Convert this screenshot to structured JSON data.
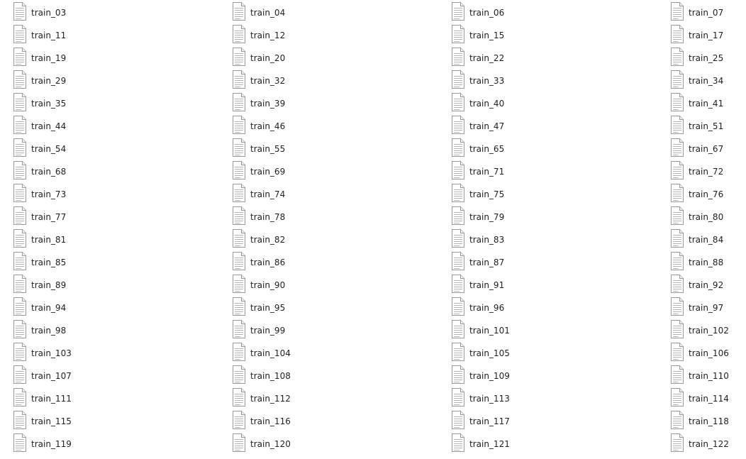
{
  "file_icon": "text-document-icon",
  "rows": [
    [
      "train_03",
      "train_04",
      "train_06",
      "train_07"
    ],
    [
      "train_11",
      "train_12",
      "train_15",
      "train_17"
    ],
    [
      "train_19",
      "train_20",
      "train_22",
      "train_25"
    ],
    [
      "train_29",
      "train_32",
      "train_33",
      "train_34"
    ],
    [
      "train_35",
      "train_39",
      "train_40",
      "train_41"
    ],
    [
      "train_44",
      "train_46",
      "train_47",
      "train_51"
    ],
    [
      "train_54",
      "train_55",
      "train_65",
      "train_67"
    ],
    [
      "train_68",
      "train_69",
      "train_71",
      "train_72"
    ],
    [
      "train_73",
      "train_74",
      "train_75",
      "train_76"
    ],
    [
      "train_77",
      "train_78",
      "train_79",
      "train_80"
    ],
    [
      "train_81",
      "train_82",
      "train_83",
      "train_84"
    ],
    [
      "train_85",
      "train_86",
      "train_87",
      "train_88"
    ],
    [
      "train_89",
      "train_90",
      "train_91",
      "train_92"
    ],
    [
      "train_94",
      "train_95",
      "train_96",
      "train_97"
    ],
    [
      "train_98",
      "train_99",
      "train_101",
      "train_102"
    ],
    [
      "train_103",
      "train_104",
      "train_105",
      "train_106"
    ],
    [
      "train_107",
      "train_108",
      "train_109",
      "train_110"
    ],
    [
      "train_111",
      "train_112",
      "train_113",
      "train_114"
    ],
    [
      "train_115",
      "train_116",
      "train_117",
      "train_118"
    ],
    [
      "train_119",
      "train_120",
      "train_121",
      "train_122"
    ]
  ]
}
